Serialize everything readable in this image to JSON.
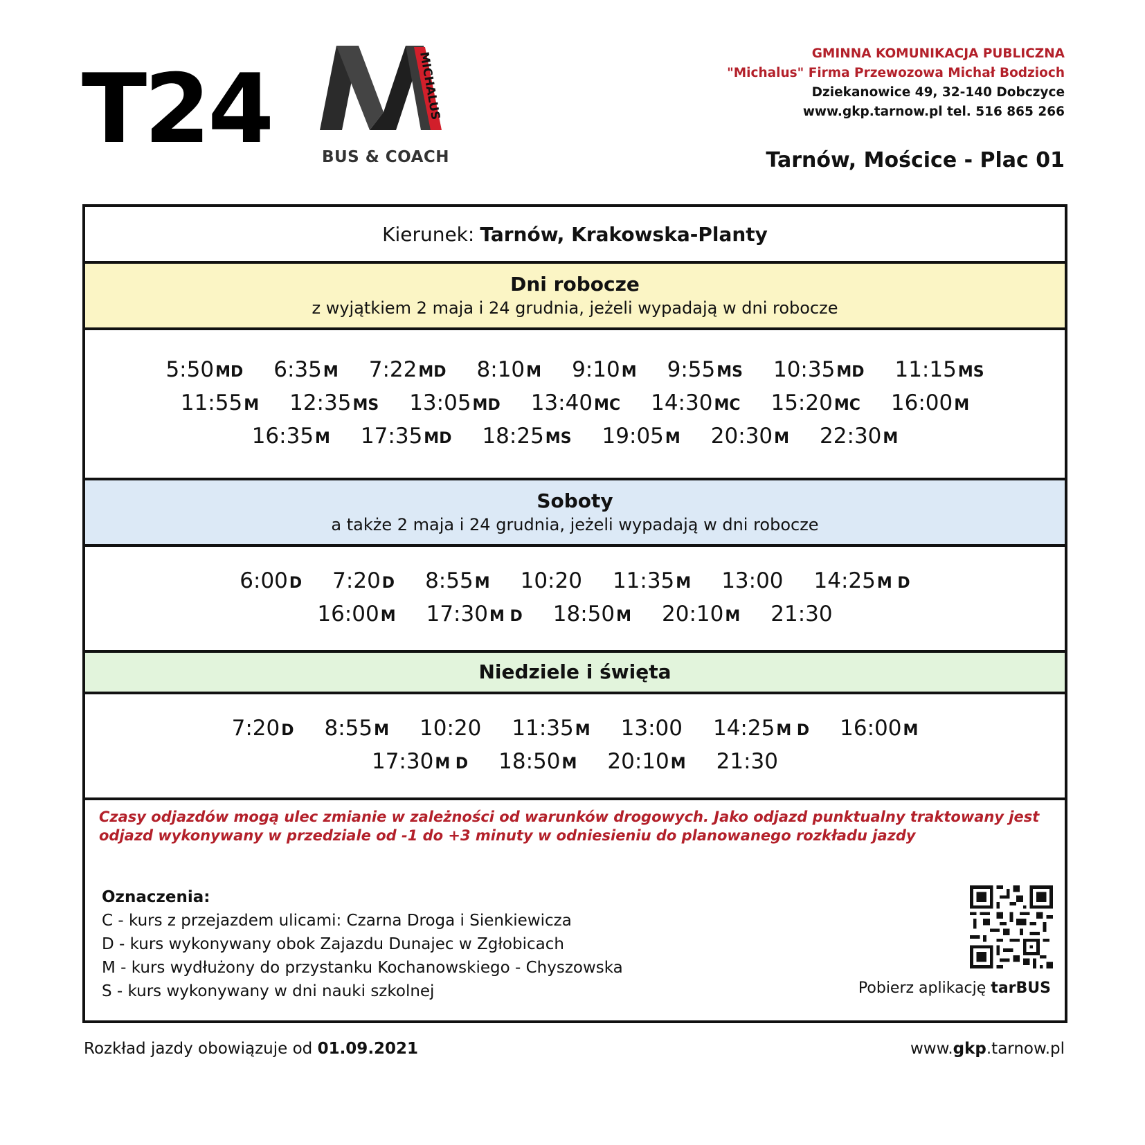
{
  "header": {
    "line": "T24",
    "logo_vertical_text": "MICHALUS",
    "logo_caption": "BUS & COACH",
    "operator_line1": "GMINNA KOMUNIKACJA PUBLICZNA",
    "operator_line2": "\"Michalus\" Firma Przewozowa Michał Bodzioch",
    "operator_line3": "Dziekanowice 49, 32-140 Dobczyce",
    "operator_line4": "www.gkp.tarnow.pl tel. 516 865 266",
    "stop": "Tarnów, Mościce - Plac 01"
  },
  "direction": {
    "label": "Kierunek:",
    "value": "Tarnów, Krakowska-Planty"
  },
  "sections": [
    {
      "title": "Dni robocze",
      "subtitle": "z wyjątkiem 2 maja i 24 grudnia, jeżeli wypadają w dni robocze",
      "color": "#fbf5c5",
      "departures": [
        {
          "time": "5:50",
          "code": "MD"
        },
        {
          "time": "6:35",
          "code": "M"
        },
        {
          "time": "7:22",
          "code": "MD"
        },
        {
          "time": "8:10",
          "code": "M"
        },
        {
          "time": "9:10",
          "code": "M"
        },
        {
          "time": "9:55",
          "code": "MS"
        },
        {
          "time": "10:35",
          "code": "MD"
        },
        {
          "time": "11:15",
          "code": "MS"
        },
        {
          "time": "11:55",
          "code": "M"
        },
        {
          "time": "12:35",
          "code": "MS"
        },
        {
          "time": "13:05",
          "code": "MD"
        },
        {
          "time": "13:40",
          "code": "MC"
        },
        {
          "time": "14:30",
          "code": "MC"
        },
        {
          "time": "15:20",
          "code": "MC"
        },
        {
          "time": "16:00",
          "code": "M"
        },
        {
          "time": "16:35",
          "code": "M"
        },
        {
          "time": "17:35",
          "code": "MD"
        },
        {
          "time": "18:25",
          "code": "MS"
        },
        {
          "time": "19:05",
          "code": "M"
        },
        {
          "time": "20:30",
          "code": "M"
        },
        {
          "time": "22:30",
          "code": "M"
        }
      ]
    },
    {
      "title": "Soboty",
      "subtitle": "a także 2 maja i 24 grudnia, jeżeli wypadają w dni robocze",
      "color": "#dce9f6",
      "departures": [
        {
          "time": "6:00",
          "code": "D"
        },
        {
          "time": "7:20",
          "code": "D"
        },
        {
          "time": "8:55",
          "code": "M"
        },
        {
          "time": "10:20",
          "code": ""
        },
        {
          "time": "11:35",
          "code": "M"
        },
        {
          "time": "13:00",
          "code": ""
        },
        {
          "time": "14:25",
          "code": "M D"
        },
        {
          "time": "16:00",
          "code": "M"
        },
        {
          "time": "17:30",
          "code": "M D"
        },
        {
          "time": "18:50",
          "code": "M"
        },
        {
          "time": "20:10",
          "code": "M"
        },
        {
          "time": "21:30",
          "code": ""
        }
      ]
    },
    {
      "title": "Niedziele i święta",
      "subtitle": "",
      "color": "#e2f4dc",
      "departures": [
        {
          "time": "7:20",
          "code": "D"
        },
        {
          "time": "8:55",
          "code": "M"
        },
        {
          "time": "10:20",
          "code": ""
        },
        {
          "time": "11:35",
          "code": "M"
        },
        {
          "time": "13:00",
          "code": ""
        },
        {
          "time": "14:25",
          "code": "M D"
        },
        {
          "time": "16:00",
          "code": "M"
        },
        {
          "time": "17:30",
          "code": "M D"
        },
        {
          "time": "18:50",
          "code": "M"
        },
        {
          "time": "20:10",
          "code": "M"
        },
        {
          "time": "21:30",
          "code": ""
        }
      ]
    }
  ],
  "note": "Czasy odjazdów mogą ulec zmianie w zależności od warunków drogowych. Jako odjazd punktualny traktowany jest odjazd wykonywany w przedziale od -1 do +3 minuty w odniesieniu do planowanego rozkładu jazdy",
  "legend": {
    "title": "Oznaczenia:",
    "items": [
      "C - kurs z przejazdem ulicami: Czarna Droga i Sienkiewicza",
      "D - kurs wykonywany obok Zajazdu Dunajec w Zgłobicach",
      "M - kurs wydłużony do przystanku Kochanowskiego - Chyszowska",
      "S - kurs wykonywany w dni nauki szkolnej"
    ]
  },
  "app": {
    "prefix": "Pobierz aplikację",
    "name": "tarBUS"
  },
  "footer": {
    "valid_prefix": "Rozkład jazdy obowiązuje od",
    "valid_date": "01.09.2021",
    "website_prefix": "www.",
    "website_bold": "gkp",
    "website_suffix": ".tarnow.pl"
  },
  "colors": {
    "accent_red": "#b3202a",
    "logo_dark": "#2f2f2f"
  }
}
